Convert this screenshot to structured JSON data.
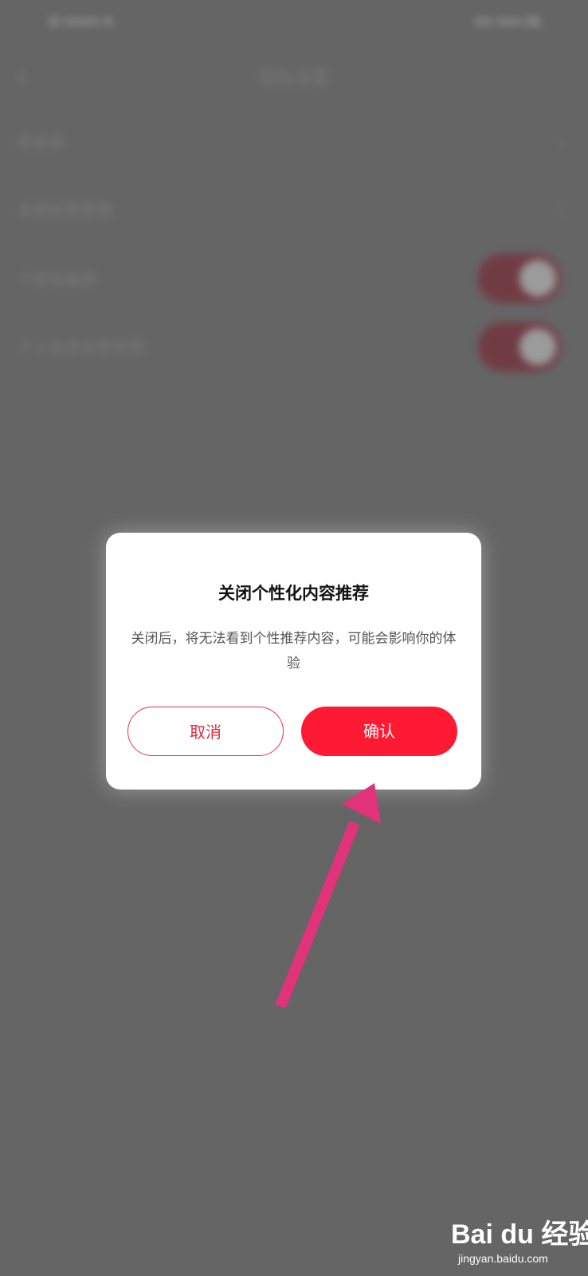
{
  "background": {
    "nav_title": "隐私设置",
    "back_icon": "chevron-left-icon",
    "rows": [
      {
        "label": "黑名单",
        "control": "arrow"
      },
      {
        "label": "系统权限管理",
        "control": "arrow"
      },
      {
        "label": "个性化推荐",
        "control": "toggle",
        "on": true
      },
      {
        "label": "个人信息共享权限",
        "control": "toggle",
        "on": true
      }
    ]
  },
  "dialog": {
    "title": "关闭个性化内容推荐",
    "message": "关闭后，将无法看到个性推荐内容，可能会影响你的体验",
    "cancel_label": "取消",
    "confirm_label": "确认"
  },
  "watermark": {
    "logo": "Bai du 经验",
    "url": "jingyan.baidu.com"
  },
  "colors": {
    "overlay": "#656565",
    "primary": "#ff1a33",
    "arrow": "#e0337a"
  }
}
